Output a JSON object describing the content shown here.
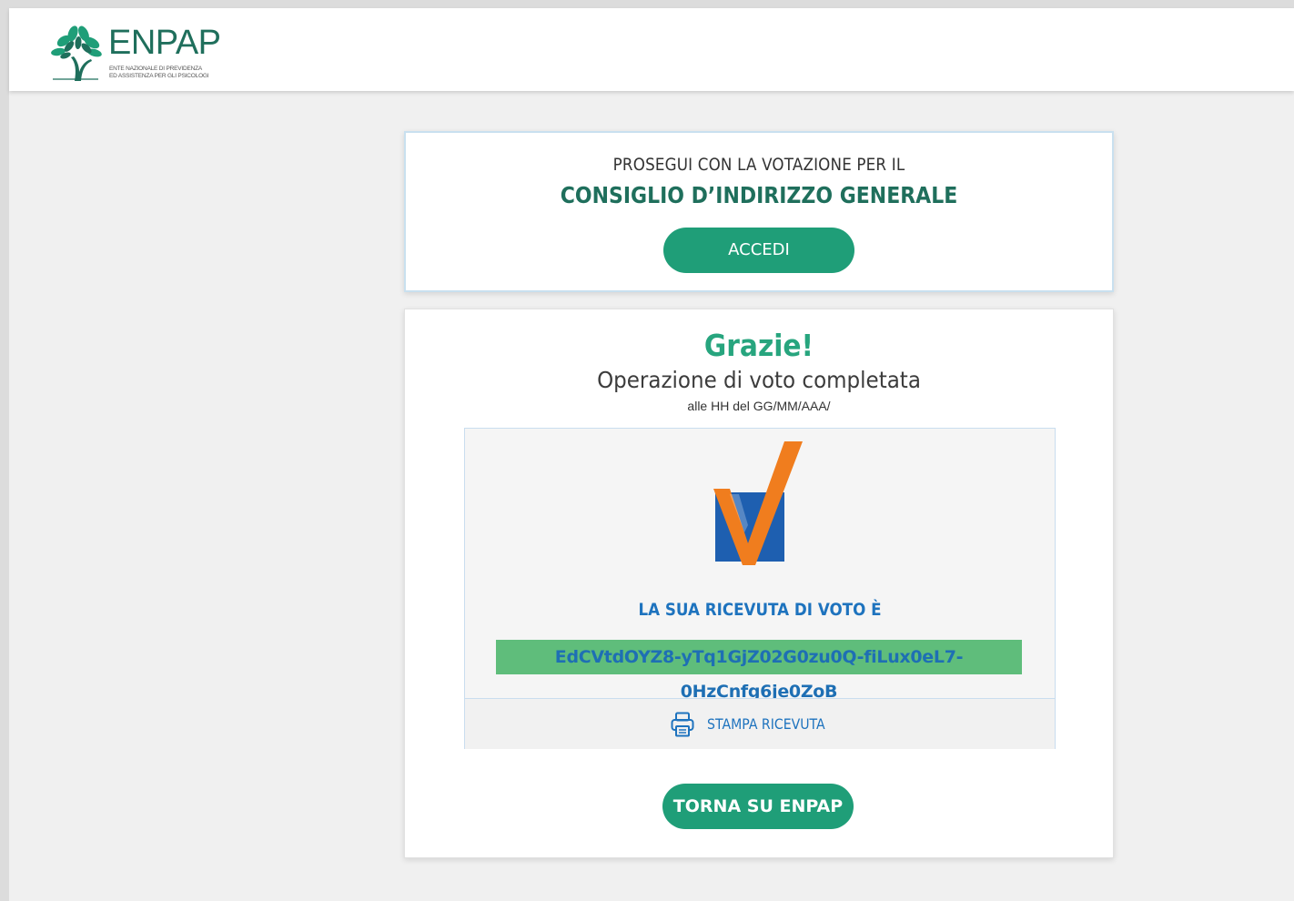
{
  "header": {
    "logo_word": "ENPAP",
    "logo_subtitle_line1": "ENTE NAZIONALE DI PREVIDENZA",
    "logo_subtitle_line2": "ED ASSISTENZA PER GLI PSICOLOGI"
  },
  "next_vote": {
    "intro": "PROSEGUI CON LA VOTAZIONE PER IL",
    "body_name": "CONSIGLIO D’INDIRIZZO GENERALE",
    "button_label": "ACCEDI"
  },
  "confirmation": {
    "thanks": "Grazie!",
    "message": "Operazione di voto completata",
    "timestamp": "alle HH del GG/MM/AAA/",
    "receipt_label": "LA SUA RICEVUTA DI VOTO È",
    "receipt_code": "EdCVtdOYZ8-yTq1GjZ02G0zu0Q-fiLux0eL7-0HzCnfg6je0ZoB",
    "print_label": "STAMPA RICEVUTA",
    "back_button_label": "TORNA SU ENPAP"
  },
  "colors": {
    "brand_green": "#1f6f5c",
    "button_green": "#1f9e78",
    "accent_blue": "#1e73be",
    "receipt_bg": "#5fbd7b",
    "check_orange": "#f07d1e"
  },
  "icons": {
    "logo": "olive-tree-icon",
    "vote_logo": "checkmark-vote-icon",
    "print": "printer-icon"
  }
}
